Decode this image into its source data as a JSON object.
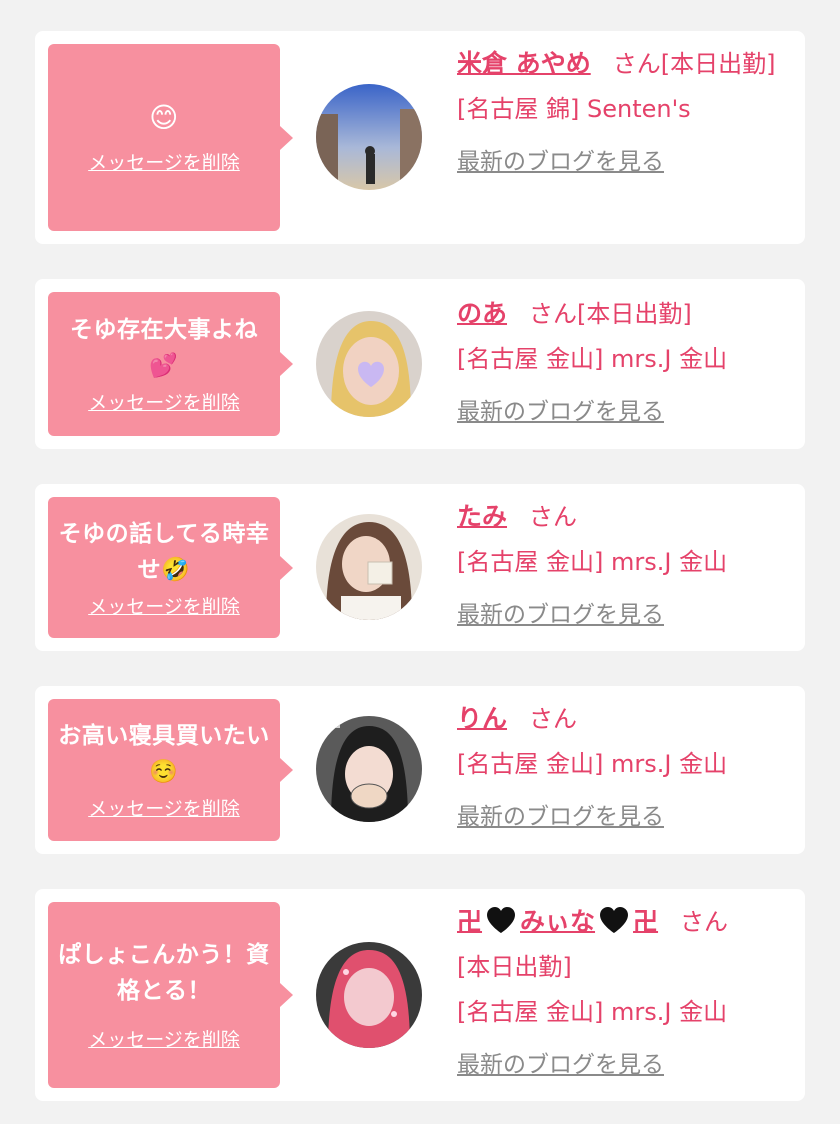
{
  "colors": {
    "accent": "#e5426a",
    "bubble": "#f7909f",
    "link_gray": "#8a8a8a",
    "background": "#f2f2f2"
  },
  "delete_label": "メッセージを削除",
  "blog_label": "最新のブログを見る",
  "san": "さん",
  "cards": [
    {
      "message": "😊",
      "name": "米倉 あやめ",
      "status": "[本日出勤]",
      "shop": "[名古屋 錦] Senten's"
    },
    {
      "message": "そゆ存在大事よね💕",
      "name": "のあ",
      "status": "[本日出勤]",
      "shop": "[名古屋 金山] mrs.J 金山"
    },
    {
      "message": "そゆの話してる時幸せ🤣",
      "name": "たみ",
      "status": "",
      "shop": "[名古屋 金山] mrs.J 金山"
    },
    {
      "message": "お高い寝具買いたい☺️",
      "name": "りん",
      "status": "",
      "shop": "[名古屋 金山] mrs.J 金山"
    },
    {
      "message": "ぱしょこんかう！資格とる！",
      "name_parts": [
        "卍",
        "みぃな",
        "卍"
      ],
      "status": "[本日出勤]",
      "shop": "[名古屋 金山] mrs.J 金山"
    }
  ]
}
